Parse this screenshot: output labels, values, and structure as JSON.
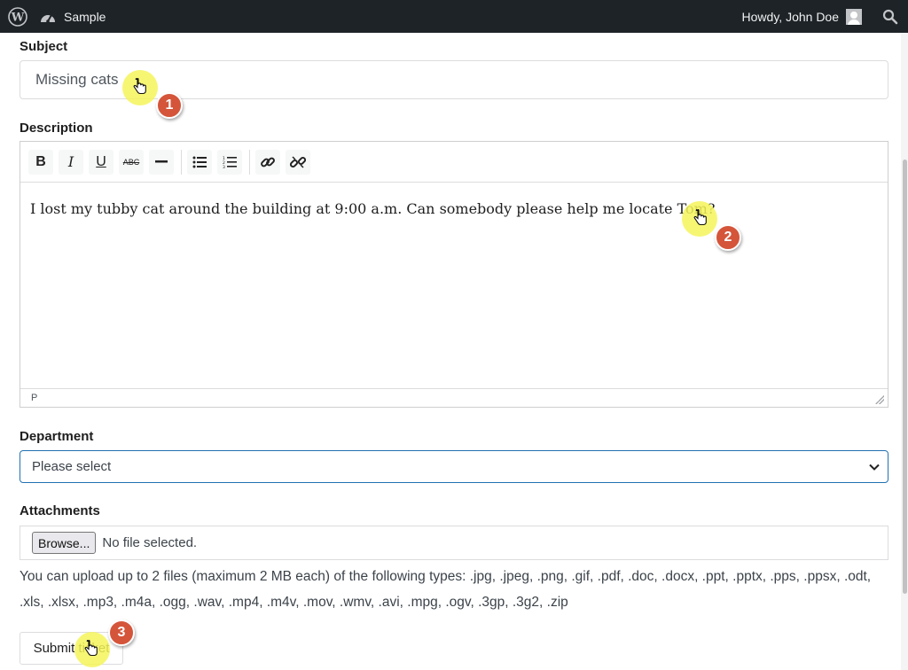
{
  "adminbar": {
    "logo_icon": "wordpress-logo-icon",
    "site_icon": "dashboard-gauge-icon",
    "site_name": "Sample",
    "greeting": "Howdy, John Doe",
    "search_icon": "search-icon"
  },
  "form": {
    "subject": {
      "label": "Subject",
      "value": "Missing cats"
    },
    "description": {
      "label": "Description",
      "toolbar": [
        "bold-icon",
        "italic-icon",
        "underline-icon",
        "strikethrough-icon",
        "horizontal-line-icon",
        "bullet-list-icon",
        "numbered-list-icon",
        "link-icon",
        "unlink-icon"
      ],
      "content": "I lost my tubby cat around the building at 9:00 a.m. Can somebody please help me locate Tom?",
      "status_path": "P"
    },
    "department": {
      "label": "Department",
      "selected": "Please select"
    },
    "attachments": {
      "label": "Attachments",
      "browse_label": "Browse...",
      "file_status": "No file selected.",
      "help": "You can upload up to 2 files (maximum 2 MB each) of the following types: .jpg, .jpeg, .png, .gif, .pdf, .doc, .docx, .ppt, .pptx, .pps, .ppsx, .odt, .xls, .xlsx, .mp3, .m4a, .ogg, .wav, .mp4, .m4v, .mov, .wmv, .avi, .mpg, .ogv, .3gp, .3g2, .zip"
    },
    "submit_label": "Submit ticket"
  },
  "annotations": {
    "steps": [
      "1",
      "2",
      "3"
    ],
    "colors": {
      "badge": "#d4553a",
      "highlight": "#f5f55a"
    }
  },
  "colors": {
    "adminbar_bg": "#1d2327",
    "focus_border": "#2271b1"
  }
}
